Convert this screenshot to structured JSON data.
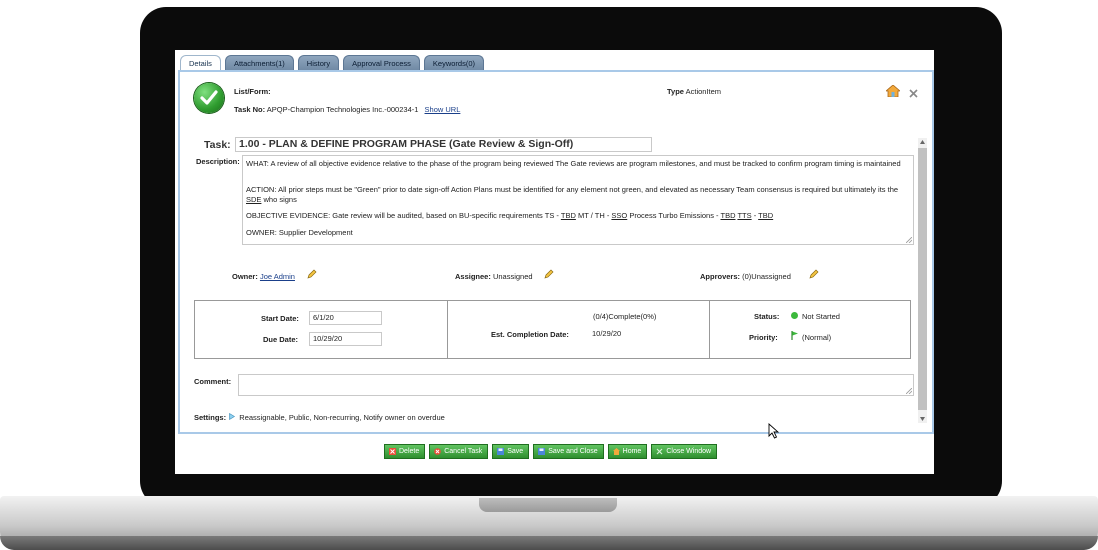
{
  "tabs": [
    {
      "label": "Details"
    },
    {
      "label": "Attachments(1)"
    },
    {
      "label": "History"
    },
    {
      "label": "Approval Process"
    },
    {
      "label": "Keywords(0)"
    }
  ],
  "header": {
    "list_form_label": "List/Form:",
    "task_no_label": "Task No:",
    "task_no_value": "APQP-Champion Technologies Inc.-000234-1",
    "show_url": "Show URL",
    "type_label": "Type",
    "type_value": "ActionItem"
  },
  "task": {
    "label": "Task:",
    "value": "1.00 - PLAN & DEFINE PROGRAM PHASE (Gate Review & Sign-Off)"
  },
  "description": {
    "label": "Description:",
    "para1": "WHAT: A review of all objective evidence relative to the phase of the program being reviewed The Gate reviews are program milestones, and must be tracked to confirm program timing is maintained",
    "para2_a": "ACTION: All prior steps must be \"Green\" prior to date sign-off Action Plans must be identified for any element not green, and elevated as necessary Team consensus is required but ultimately its the ",
    "para2_sde": "SDE",
    "para2_b": " who signs",
    "para3_a": "OBJECTIVE EVIDENCE: Gate review will be audited, based on BU-specific requirements TS - ",
    "para3_tbd1": "TBD",
    "para3_b": " MT / TH - ",
    "para3_sso": "SSO",
    "para3_c": " Process Turbo Emissions - ",
    "para3_tbd2": "TBD",
    "para3_tts": "TTS",
    "para3_d": " - ",
    "para3_tbd3": "TBD",
    "para4": "OWNER: Supplier Development"
  },
  "people": {
    "owner_label": "Owner:",
    "owner_value": "Joe Admin",
    "assignee_label": "Assignee:",
    "assignee_value": "Unassigned",
    "approvers_label": "Approvers:",
    "approvers_value": "(0)Unassigned"
  },
  "dates": {
    "start_label": "Start Date:",
    "start_value": "6/1/20",
    "due_label": "Due Date:",
    "due_value": "10/29/20",
    "progress_text": "(0/4)Complete(0%)",
    "est_label": "Est. Completion Date:",
    "est_value": "10/29/20",
    "status_label": "Status:",
    "status_value": "Not Started",
    "priority_label": "Priority:",
    "priority_value": "(Normal)"
  },
  "comment": {
    "label": "Comment:",
    "value": ""
  },
  "settings": {
    "label": "Settings:",
    "value": "Reassignable,  Public,  Non-recurring,  Notify owner on overdue"
  },
  "buttons": {
    "delete": "Delete",
    "cancel_task": "Cancel Task",
    "save": "Save",
    "save_close": "Save and Close",
    "home": "Home",
    "close_window": "Close Window"
  },
  "colors": {
    "panel_border": "#a9c9e8",
    "button_green": "#3a9a3a",
    "status_dot": "#3cb93c"
  },
  "icons": [
    "check-circle-icon",
    "home-icon",
    "close-icon",
    "pencil-icon",
    "flag-icon",
    "triangle-right-icon",
    "cursor-icon"
  ]
}
